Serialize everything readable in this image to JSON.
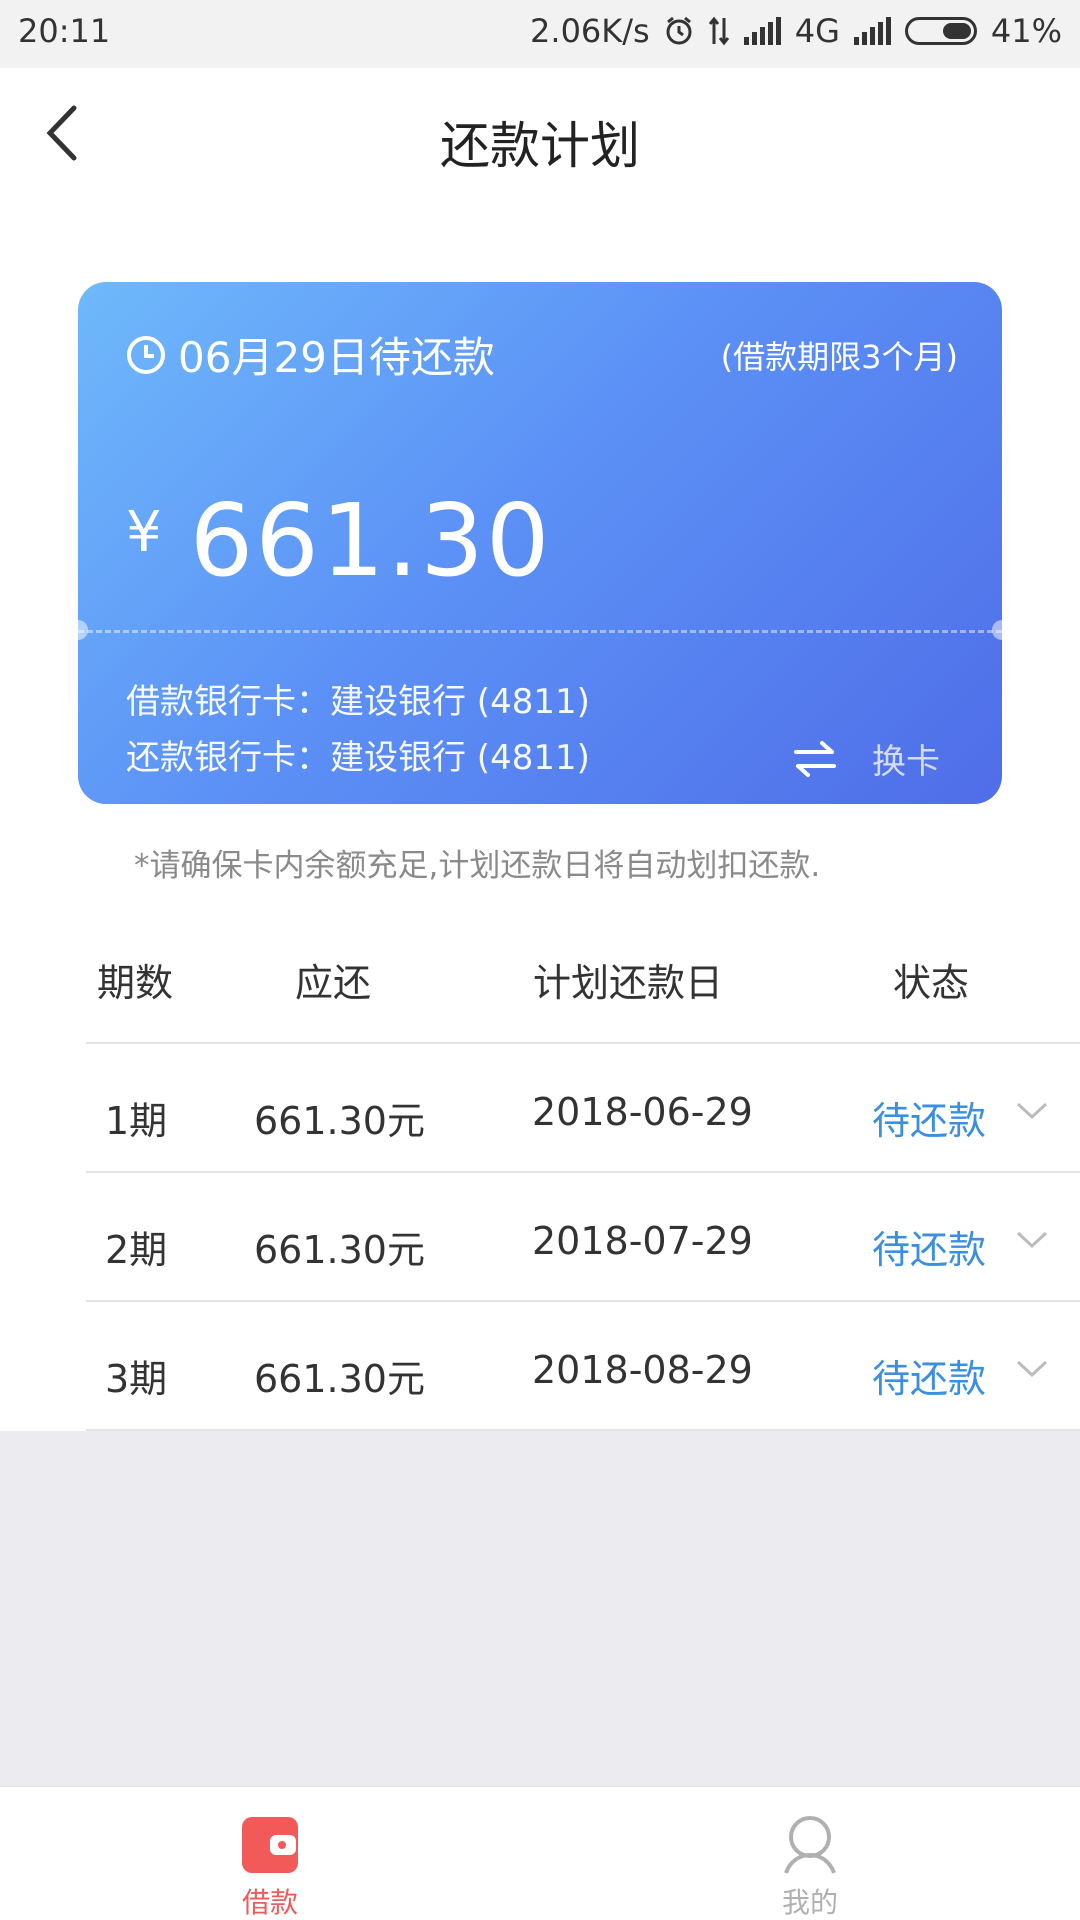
{
  "status_bar": {
    "time": "20:11",
    "net_speed": "2.06K/s",
    "network": "4G",
    "battery": "41%",
    "battery_level": 0.41
  },
  "header": {
    "title": "还款计划",
    "back_icon": "chevron-left-icon"
  },
  "card": {
    "due_text": "06月29日待还款",
    "term_text": "(借款期限3个月)",
    "currency": "¥",
    "amount": "661.30",
    "loan_card_line": "借款银行卡：建设银行 (4811)",
    "repay_card_line": "还款银行卡：建设银行 (4811)",
    "switch_label": "换卡",
    "gradient_colors": [
      "#6fb9fb",
      "#4f6de8"
    ]
  },
  "notice": "*请确保卡内余额充足,计划还款日将自动划扣还款.",
  "table": {
    "headers": [
      "期数",
      "应还",
      "计划还款日",
      "状态"
    ],
    "rows": [
      {
        "period": "1期",
        "amount": "661.30元",
        "date": "2018-06-29",
        "status": "待还款"
      },
      {
        "period": "2期",
        "amount": "661.30元",
        "date": "2018-07-29",
        "status": "待还款"
      },
      {
        "period": "3期",
        "amount": "661.30元",
        "date": "2018-08-29",
        "status": "待还款"
      }
    ],
    "status_color": "#3a8fe0"
  },
  "tabbar": {
    "items": [
      {
        "label": "借款",
        "icon": "wallet-icon",
        "active": true
      },
      {
        "label": "我的",
        "icon": "user-icon",
        "active": false
      }
    ],
    "active_color": "#f25a5a"
  }
}
